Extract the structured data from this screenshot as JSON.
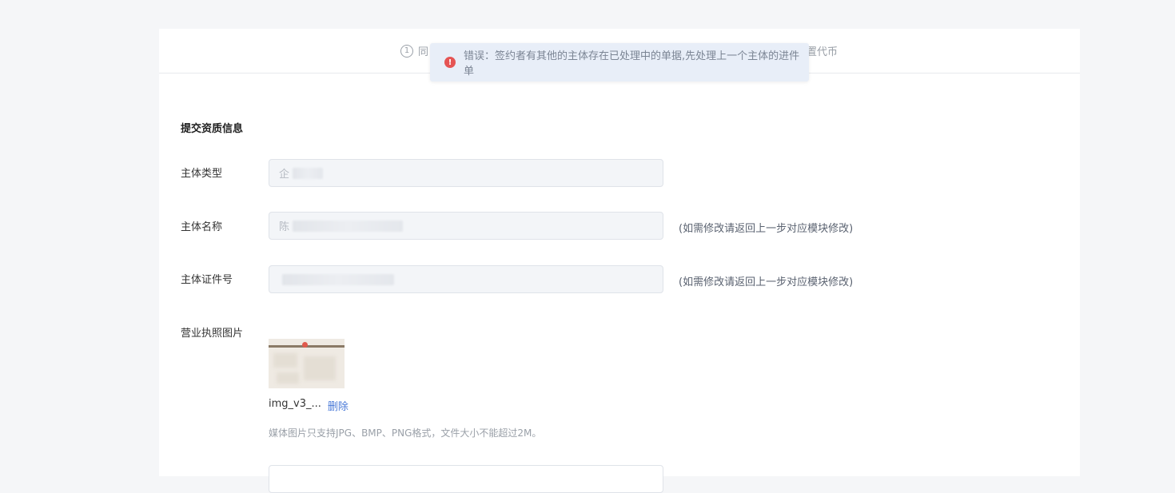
{
  "steps": {
    "left_num": "1",
    "left_text": "同",
    "right_text": "置代币"
  },
  "toast": {
    "icon": "error-icon",
    "message": "错误：签约者有其他的主体存在已处理中的单据,先处理上一个主体的进件单"
  },
  "form": {
    "section_title": "提交资质信息",
    "subject_type": {
      "label": "主体类型",
      "value": "企"
    },
    "subject_name": {
      "label": "主体名称",
      "value": "陈",
      "hint": "(如需修改请返回上一步对应模块修改)"
    },
    "subject_id": {
      "label": "主体证件号",
      "value": "",
      "hint": "(如需修改请返回上一步对应模块修改)"
    },
    "license": {
      "label": "营业执照图片",
      "file_name": "img_v3_...",
      "delete_label": "删除",
      "tip": "媒体图片只支持JPG、BMP、PNG格式，文件大小不能超过2M。"
    }
  }
}
